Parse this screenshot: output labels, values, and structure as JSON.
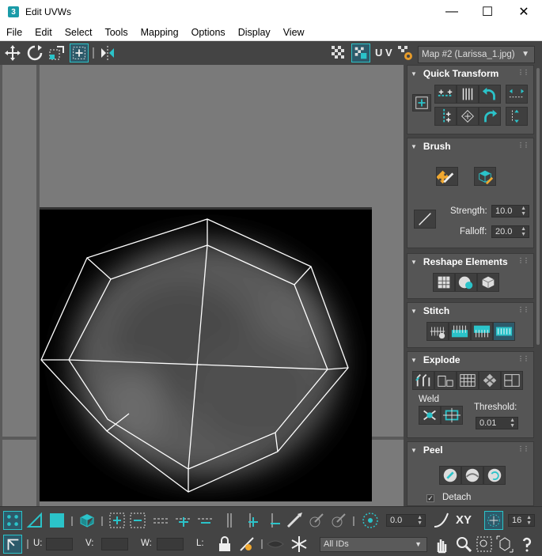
{
  "window": {
    "title": "Edit UVWs",
    "app_icon": "3",
    "controls": [
      "minimize",
      "maximize",
      "close"
    ]
  },
  "menubar": {
    "items": [
      "File",
      "Edit",
      "Select",
      "Tools",
      "Mapping",
      "Options",
      "Display",
      "View"
    ]
  },
  "toolbar_top": {
    "uv_label": "U V",
    "map_select": {
      "value": "Map #2 (Larissa_1.jpg)"
    }
  },
  "panel": {
    "quick_transform": {
      "title": "Quick Transform"
    },
    "brush": {
      "title": "Brush",
      "strength_label": "Strength:",
      "strength_value": "10.0",
      "falloff_label": "Falloff:",
      "falloff_value": "20.0"
    },
    "reshape": {
      "title": "Reshape Elements"
    },
    "stitch": {
      "title": "Stitch"
    },
    "explode": {
      "title": "Explode",
      "weld_label": "Weld",
      "threshold_label": "Threshold:",
      "threshold_value": "0.01"
    },
    "peel": {
      "title": "Peel",
      "detach_label": "Detach",
      "detach_checked": true
    }
  },
  "bottom_bar": {
    "rotate_value": "0.0",
    "xy_label": "XY",
    "count_value": "16",
    "u_label": "U:",
    "v_label": "V:",
    "w_label": "W:",
    "l_label": "L:",
    "ids_select": "All IDs"
  },
  "colors": {
    "accent": "#2bc3c9",
    "background": "#444444",
    "viewport": "#7a7a7a"
  }
}
